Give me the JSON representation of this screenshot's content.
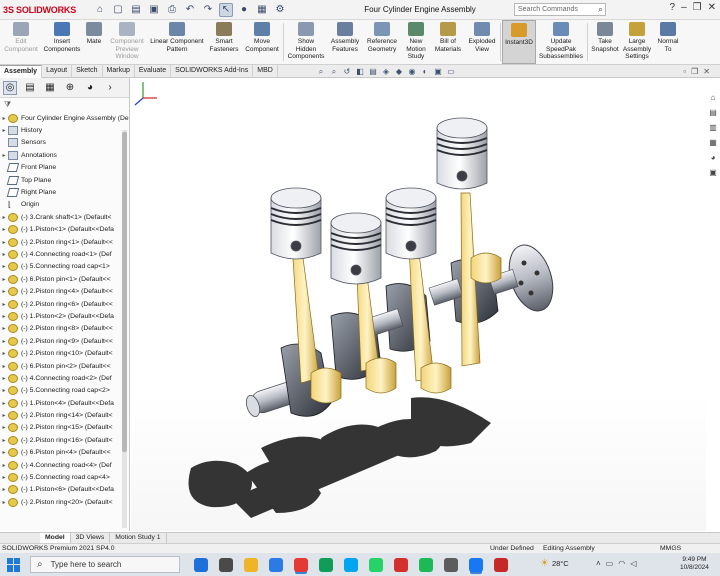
{
  "app": {
    "logo_ds": "3S",
    "logo_name": "SOLIDWORKS",
    "document_title": "Four Cylinder Engine Assembly",
    "search_placeholder": "Search Commands"
  },
  "quick_access": [
    "home-icon",
    "new-file-icon",
    "open-icon",
    "save-icon",
    "print-icon",
    "undo-icon",
    "redo-icon",
    "select-icon",
    "traffic-light-icon",
    "file-props-icon",
    "options-icon"
  ],
  "ribbon": [
    {
      "label": "Edit\nComponent",
      "dim": true,
      "color": "#9aa6b5"
    },
    {
      "label": "Insert\nComponents",
      "dim": false,
      "color": "#4a78b5"
    },
    {
      "label": "Mate",
      "dim": false,
      "color": "#7d8b9e"
    },
    {
      "label": "Component\nPreview\nWindow",
      "dim": true,
      "color": "#a9b3c2"
    },
    {
      "label": "Linear Component\nPattern",
      "dim": false,
      "color": "#6b86a8"
    },
    {
      "label": "Smart\nFasteners",
      "dim": false,
      "color": "#8a7b5a"
    },
    {
      "label": "Move\nComponent",
      "dim": false,
      "color": "#5d7fa8"
    },
    {
      "label": "Show\nHidden\nComponents",
      "dim": false,
      "color": "#8a99b0"
    },
    {
      "label": "Assembly\nFeatures",
      "dim": false,
      "color": "#6a7f9e"
    },
    {
      "label": "Reference\nGeometry",
      "dim": false,
      "color": "#7d95b5"
    },
    {
      "label": "New\nMotion\nStudy",
      "dim": false,
      "color": "#5b8a6b"
    },
    {
      "label": "Bill of\nMaterials",
      "dim": false,
      "color": "#b59a4a"
    },
    {
      "label": "Exploded\nView",
      "dim": false,
      "color": "#6f8bb0"
    },
    {
      "label": "Instant3D",
      "dim": false,
      "color": "#d89a2a",
      "active": true
    },
    {
      "label": "Update\nSpeedPak\nSubassemblies",
      "dim": false,
      "color": "#6a8ab8"
    },
    {
      "label": "Take\nSnapshot",
      "dim": false,
      "color": "#7a8796"
    },
    {
      "label": "Large\nAssembly\nSettings",
      "dim": false,
      "color": "#c4a13a"
    },
    {
      "label": "Normal\nTo",
      "dim": false,
      "color": "#5a7aa5"
    }
  ],
  "tabs": [
    {
      "label": "Assembly",
      "on": true
    },
    {
      "label": "Layout",
      "on": false
    },
    {
      "label": "Sketch",
      "on": false
    },
    {
      "label": "Markup",
      "on": false
    },
    {
      "label": "Evaluate",
      "on": false
    },
    {
      "label": "SOLIDWORKS Add-Ins",
      "on": false
    },
    {
      "label": "MBD",
      "on": false
    }
  ],
  "tree": {
    "root": "Four Cylinder Engine Assembly  (De",
    "items": [
      {
        "label": "History",
        "type": "folder",
        "arrow": true
      },
      {
        "label": "Sensors",
        "type": "folder",
        "arrow": false
      },
      {
        "label": "Annotations",
        "type": "folder",
        "arrow": true
      },
      {
        "label": "Front Plane",
        "type": "plane",
        "arrow": false
      },
      {
        "label": "Top Plane",
        "type": "plane",
        "arrow": false
      },
      {
        "label": "Right Plane",
        "type": "plane",
        "arrow": false
      },
      {
        "label": "Origin",
        "type": "origin",
        "arrow": false
      },
      {
        "label": "(-) 3.Crank shaft<1> (Default<",
        "type": "part",
        "arrow": true
      },
      {
        "label": "(-) 1.Piston<1> (Default<<Defa",
        "type": "part",
        "arrow": true
      },
      {
        "label": "(-) 2.Piston ring<1> (Default<<",
        "type": "part",
        "arrow": true
      },
      {
        "label": "(-) 4.Connecting road<1> (Def",
        "type": "part",
        "arrow": true
      },
      {
        "label": "(-) 5.Connecting road cap<1>",
        "type": "part",
        "arrow": true
      },
      {
        "label": "(-) 6.Piston pin<1> (Default<<",
        "type": "part",
        "arrow": true
      },
      {
        "label": "(-) 2.Piston ring<4> (Default<<",
        "type": "part",
        "arrow": true
      },
      {
        "label": "(-) 2.Piston ring<6> (Default<<",
        "type": "part",
        "arrow": true
      },
      {
        "label": "(-) 1.Piston<2> (Default<<Defa",
        "type": "part",
        "arrow": true
      },
      {
        "label": "(-) 2.Piston ring<8> (Default<<",
        "type": "part",
        "arrow": true
      },
      {
        "label": "(-) 2.Piston ring<9> (Default<<",
        "type": "part",
        "arrow": true
      },
      {
        "label": "(-) 2.Piston ring<10> (Default<",
        "type": "part",
        "arrow": true
      },
      {
        "label": "(-) 6.Piston pin<2> (Default<<",
        "type": "part",
        "arrow": true
      },
      {
        "label": "(-) 4.Connecting road<2> (Def",
        "type": "part",
        "arrow": true
      },
      {
        "label": "(-) 5.Connecting road cap<2>",
        "type": "part",
        "arrow": true
      },
      {
        "label": "(-) 1.Piston<4> (Default<<Defa",
        "type": "part",
        "arrow": true
      },
      {
        "label": "(-) 2.Piston ring<14> (Default<",
        "type": "part",
        "arrow": true
      },
      {
        "label": "(-) 2.Piston ring<15> (Default<",
        "type": "part",
        "arrow": true
      },
      {
        "label": "(-) 2.Piston ring<16> (Default<",
        "type": "part",
        "arrow": true
      },
      {
        "label": "(-) 6.Piston pin<4> (Default<<",
        "type": "part",
        "arrow": true
      },
      {
        "label": "(-) 4.Connecting road<4> (Def",
        "type": "part",
        "arrow": true
      },
      {
        "label": "(-) 5.Connecting road cap<4>",
        "type": "part",
        "arrow": true
      },
      {
        "label": "(-) 1.Piston<6> (Default<<Defa",
        "type": "part",
        "arrow": true
      },
      {
        "label": "(-) 2.Piston ring<20> (Default<",
        "type": "part",
        "arrow": true
      }
    ]
  },
  "bottom_tabs": [
    {
      "label": "Model",
      "on": true
    },
    {
      "label": "3D Views",
      "on": false
    },
    {
      "label": "Motion Study 1",
      "on": false
    }
  ],
  "status": {
    "product": "SOLIDWORKS Premium 2021 SP4.0",
    "defined": "Under Defined",
    "mode": "Editing Assembly",
    "units": "MMGS"
  },
  "taskbar": {
    "search_placeholder": "Type here to search",
    "temperature": "28°C",
    "time": "9:49 PM",
    "date": "10/8/2024",
    "apps": [
      "#1e6fd9",
      "#4a4a4a",
      "#f0b429",
      "#2c7be5",
      "#e53935",
      "#0f9d58",
      "#00a4ef",
      "#25d366",
      "#d32f2f",
      "#1db954",
      "#5c5c5c",
      "#1877f2",
      "#c62828"
    ]
  }
}
